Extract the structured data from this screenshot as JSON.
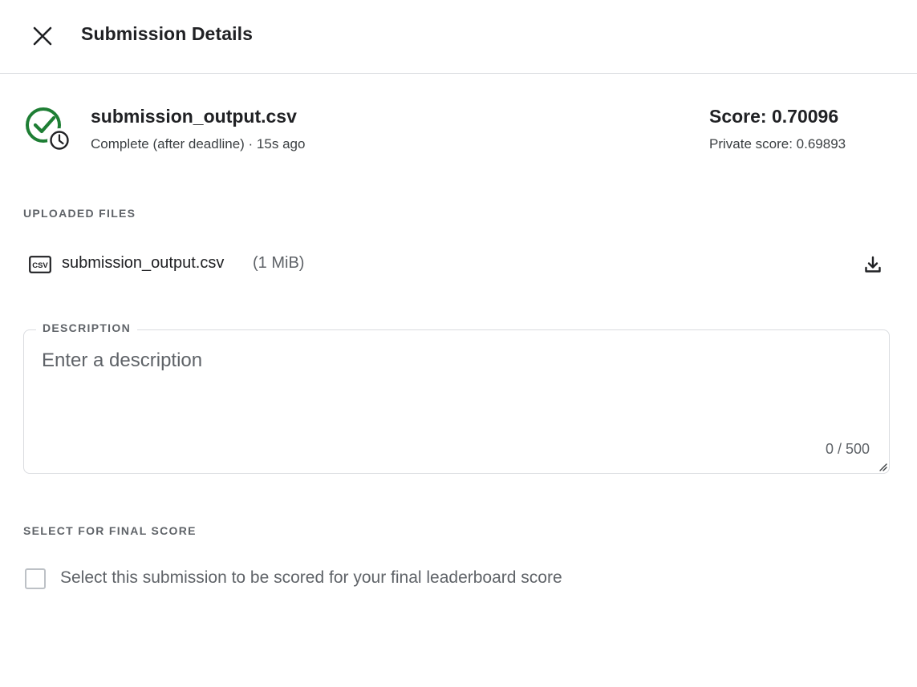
{
  "header": {
    "title": "Submission Details",
    "close_icon": "close-icon"
  },
  "submission": {
    "status_icon": "check-circle-with-clock-icon",
    "file_name": "submission_output.csv",
    "status_text": "Complete (after deadline) · 15s ago",
    "score_text": "Score: 0.70096",
    "private_score_text": "Private score: 0.69893",
    "status_color": "#1e7e34"
  },
  "uploaded_files": {
    "label": "UPLOADED FILES",
    "files": [
      {
        "icon": "csv-file-icon",
        "name": "submission_output.csv",
        "size": "(1 MiB)",
        "download_icon": "download-icon"
      }
    ]
  },
  "description": {
    "label": "DESCRIPTION",
    "value": "",
    "placeholder": "Enter a description",
    "char_count": "0 / 500"
  },
  "final_score": {
    "label": "SELECT FOR FINAL SCORE",
    "checkbox_checked": false,
    "checkbox_label": "Select this submission to be scored for your final leaderboard score"
  }
}
